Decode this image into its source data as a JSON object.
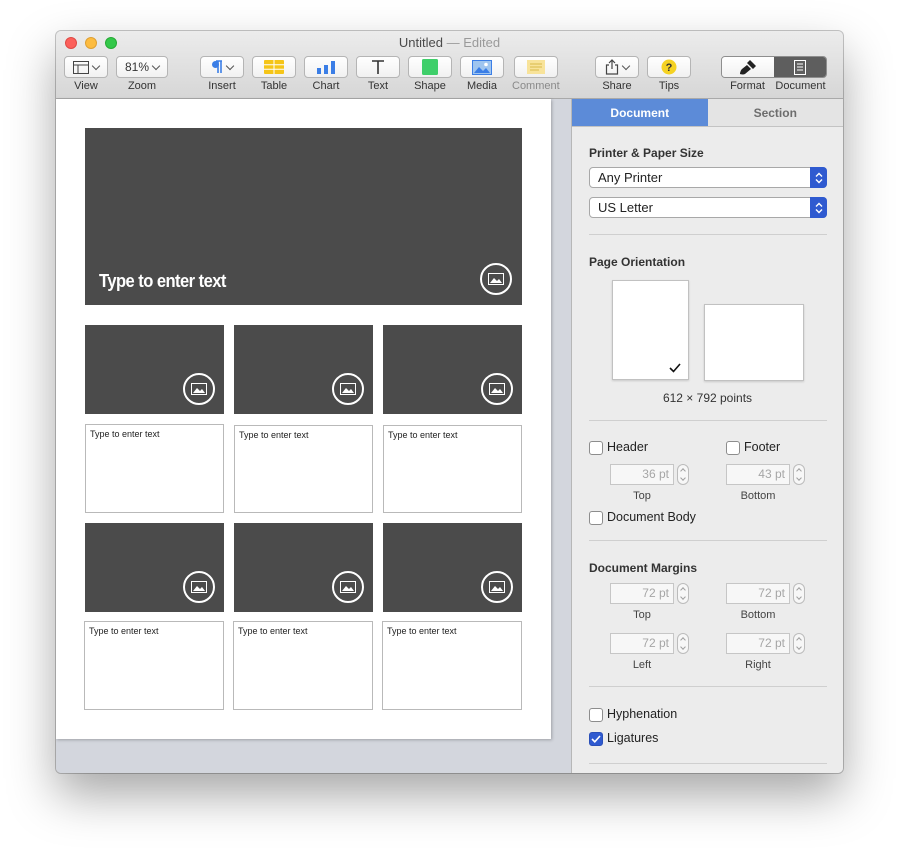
{
  "window": {
    "title": "Untitled",
    "separator": "—",
    "status": "Edited"
  },
  "toolbar": {
    "view_label": "View",
    "zoom_value": "81%",
    "zoom_label": "Zoom",
    "insert_label": "Insert",
    "table_label": "Table",
    "chart_label": "Chart",
    "text_label": "Text",
    "shape_label": "Shape",
    "media_label": "Media",
    "comment_label": "Comment",
    "share_label": "Share",
    "tips_label": "Tips",
    "format_label": "Format",
    "document_label": "Document"
  },
  "document": {
    "hero_text": "Type to enter text",
    "placeholders": [
      "Type to enter text",
      "Type to enter text",
      "Type to enter text",
      "Type to enter text",
      "Type to enter text",
      "Type to enter text"
    ]
  },
  "inspector": {
    "tabs": [
      "Document",
      "Section"
    ],
    "printer_title": "Printer & Paper Size",
    "printer_value": "Any Printer",
    "paper_value": "US Letter",
    "orientation_title": "Page Orientation",
    "page_size": "612 × 792 points",
    "header_label": "Header",
    "footer_label": "Footer",
    "header_value": "36 pt",
    "footer_value": "43 pt",
    "top_label": "Top",
    "bottom_label": "Bottom",
    "body_label": "Document Body",
    "margins_title": "Document Margins",
    "margin_top": "72 pt",
    "margin_bottom": "72 pt",
    "margin_left": "72 pt",
    "margin_right": "72 pt",
    "left_label": "Left",
    "right_label": "Right",
    "hyphenation_label": "Hyphenation",
    "ligatures_label": "Ligatures"
  },
  "colors": {
    "accent": "#2f5ad0",
    "tab_active": "#5c8bd8",
    "placeholder_dark": "#4b4b4b"
  }
}
